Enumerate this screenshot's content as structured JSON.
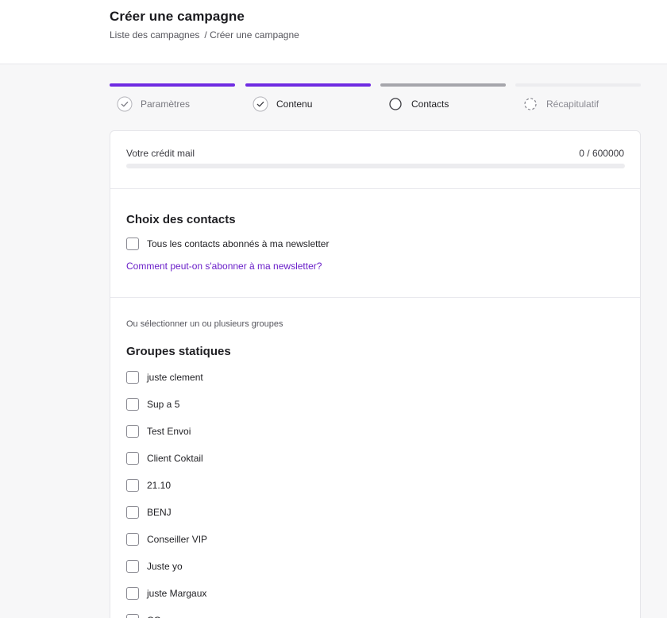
{
  "header": {
    "title": "Créer une campagne",
    "breadcrumb": {
      "link": "Liste des campagnes",
      "separator": "/",
      "current": "Créer une campagne"
    }
  },
  "steps": [
    {
      "label": "Paramètres",
      "state": "done",
      "bar_color": "#6f2be2",
      "icon": "check-circle-icon"
    },
    {
      "label": "Contenu",
      "state": "done",
      "bar_color": "#6f2be2",
      "icon": "check-circle-icon"
    },
    {
      "label": "Contacts",
      "state": "current",
      "bar_color": "#a6a6ac",
      "icon": "circle-icon"
    },
    {
      "label": "Récapitulatif",
      "state": "upcoming",
      "bar_color": "#ececef",
      "icon": "dashed-circle-icon"
    }
  ],
  "credit": {
    "label": "Votre crédit mail",
    "value": "0 / 600000",
    "used_fraction": 0
  },
  "contacts": {
    "title": "Choix des contacts",
    "all_subscribers_label": "Tous les contacts abonnés à ma newsletter",
    "help_link": "Comment peut-on s'abonner à ma newsletter?"
  },
  "groups": {
    "hint": "Ou sélectionner un ou plusieurs groupes",
    "static_title": "Groupes statiques",
    "items": [
      "juste clement",
      "Sup a 5",
      "Test Envoi",
      "Client Coktail",
      "21.10",
      "BENJ",
      "Conseiller VIP",
      "Juste yo",
      "juste Margaux",
      "CO"
    ]
  },
  "colors": {
    "accent": "#6f2be2",
    "link": "#6a1fc9"
  }
}
